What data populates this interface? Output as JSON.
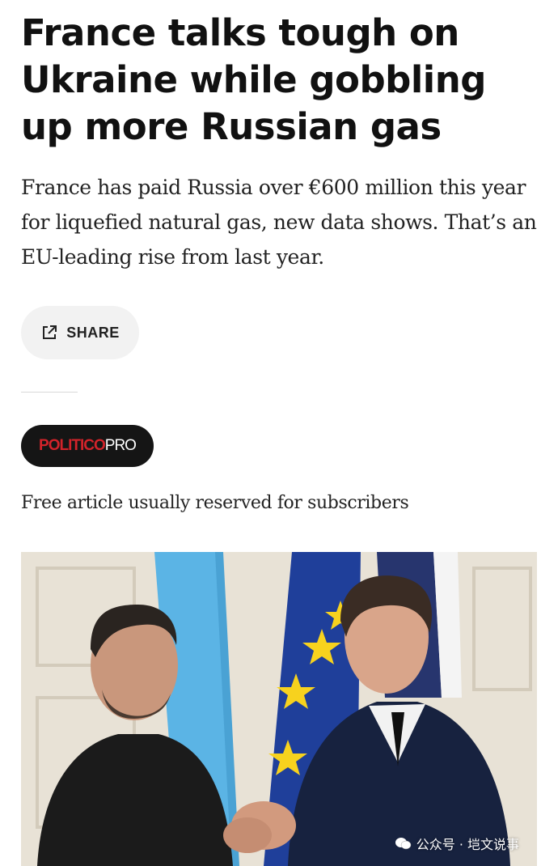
{
  "article": {
    "headline": "France talks tough on Ukraine while gobbling up more Russian gas",
    "dek": "France has paid Russia over €600 million this year for liquefied natural gas, new data shows. That’s an EU-leading rise from last year.",
    "share_label": "SHARE",
    "badge": {
      "politico": "POLITICO",
      "pro": "PRO"
    },
    "free_note": "Free article usually reserved for subscribers"
  },
  "watermark": {
    "text": "公众号 · 垲文说事"
  },
  "colors": {
    "politico_red": "#d2232a",
    "badge_bg": "#151515",
    "share_bg": "#f2f2f2",
    "ukraine_blue": "#5bb4e5",
    "eu_blue": "#1f3f9a",
    "eu_star": "#f7d21e",
    "suit_navy": "#17223f"
  }
}
